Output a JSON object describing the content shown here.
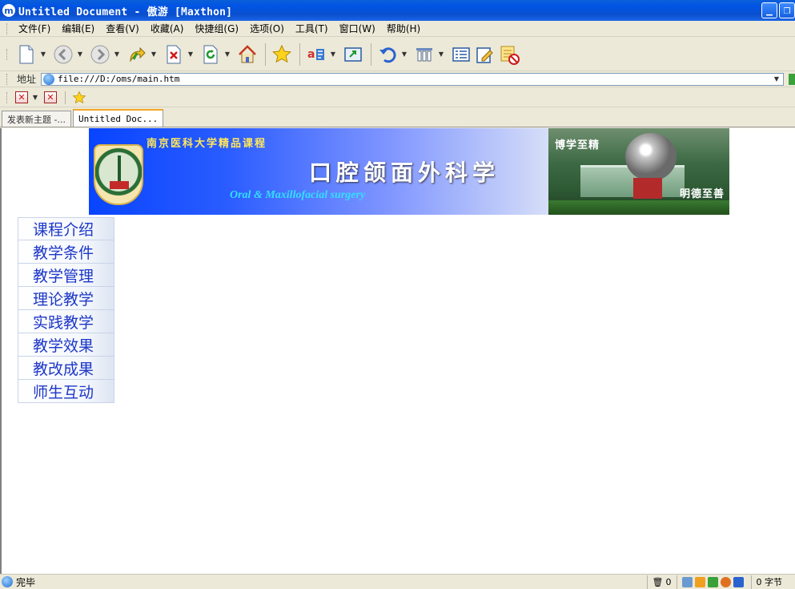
{
  "window": {
    "title": "Untitled Document - 傲游 [Maxthon]",
    "app_icon": "maxthon-logo-icon",
    "app_icon_glyph": "m"
  },
  "menu": {
    "items": [
      {
        "label": "文件(F)"
      },
      {
        "label": "编辑(E)"
      },
      {
        "label": "查看(V)"
      },
      {
        "label": "收藏(A)"
      },
      {
        "label": "快捷组(G)"
      },
      {
        "label": "选项(O)"
      },
      {
        "label": "工具(T)"
      },
      {
        "label": "窗口(W)"
      },
      {
        "label": "帮助(H)"
      }
    ]
  },
  "toolbar": {
    "icons": [
      "new-page-icon",
      "back-icon",
      "forward-icon",
      "up-icon",
      "stop-icon",
      "refresh-icon",
      "home-icon",
      "favorites-icon",
      "translate-icon",
      "fullscreen-icon",
      "undo-icon",
      "columns-icon",
      "list-view-icon",
      "edit-icon",
      "block-icon"
    ]
  },
  "address": {
    "label": "地址",
    "url": "file:///D:/oms/main.htm"
  },
  "tabs": [
    {
      "label": "发表新主题 -..."
    },
    {
      "label": "Untitled Doc..."
    }
  ],
  "banner": {
    "subtitle": "南京医科大学精品课程",
    "title": "口腔颌面外科学",
    "english": "Oral & Maxillofacial surgery",
    "motto_top": "博学至精",
    "motto_bottom": "明德至善"
  },
  "nav": {
    "items": [
      {
        "label": "课程介绍"
      },
      {
        "label": "教学条件"
      },
      {
        "label": "教学管理"
      },
      {
        "label": "理论教学"
      },
      {
        "label": "实践教学"
      },
      {
        "label": "教学效果"
      },
      {
        "label": "教改成果"
      },
      {
        "label": "师生互动"
      }
    ]
  },
  "status": {
    "text": "完毕",
    "trash_count": "0",
    "bytes": "0 字节"
  },
  "colors": {
    "nav_text": "#1c37c8",
    "banner_blue": "#0844ff",
    "banner_subtitle": "#ffe75a",
    "banner_english": "#33e0ff"
  }
}
